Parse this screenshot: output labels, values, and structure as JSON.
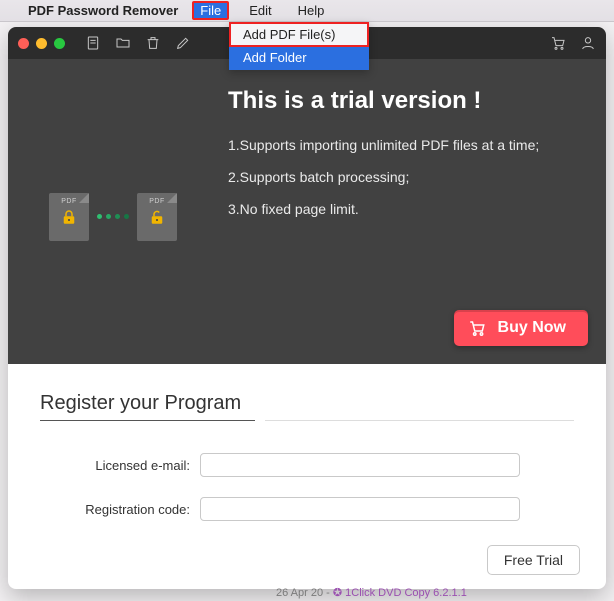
{
  "menubar": {
    "app_name": "PDF Password Remover",
    "items": {
      "file": "File",
      "edit": "Edit",
      "help": "Help"
    }
  },
  "dropdown": {
    "add_files": "Add PDF File(s)",
    "add_folder": "Add Folder"
  },
  "toolbar_icons": {
    "doc": "doc-icon",
    "folder": "folder-icon",
    "trash": "trash-icon",
    "edit": "pencil-icon",
    "cart": "cart-icon",
    "user": "user-icon"
  },
  "hero": {
    "title": "This is a trial version !",
    "line1": "1.Supports importing unlimited PDF files at a time;",
    "line2": "2.Supports batch processing;",
    "line3": "3.No fixed page limit.",
    "buy_label": "Buy Now",
    "pdf_badge": "PDF"
  },
  "register": {
    "title": "Register your Program",
    "email_label": "Licensed e-mail:",
    "code_label": "Registration code:",
    "email_value": "",
    "code_value": "",
    "free_trial_label": "Free Trial"
  },
  "footer": {
    "date": "26 Apr 20 - ",
    "link": "1Click DVD Copy 6.2.1.1"
  },
  "colors": {
    "accent_blue": "#2b6fe0",
    "accent_red": "#ff4d5a",
    "highlight_border": "#e22"
  }
}
